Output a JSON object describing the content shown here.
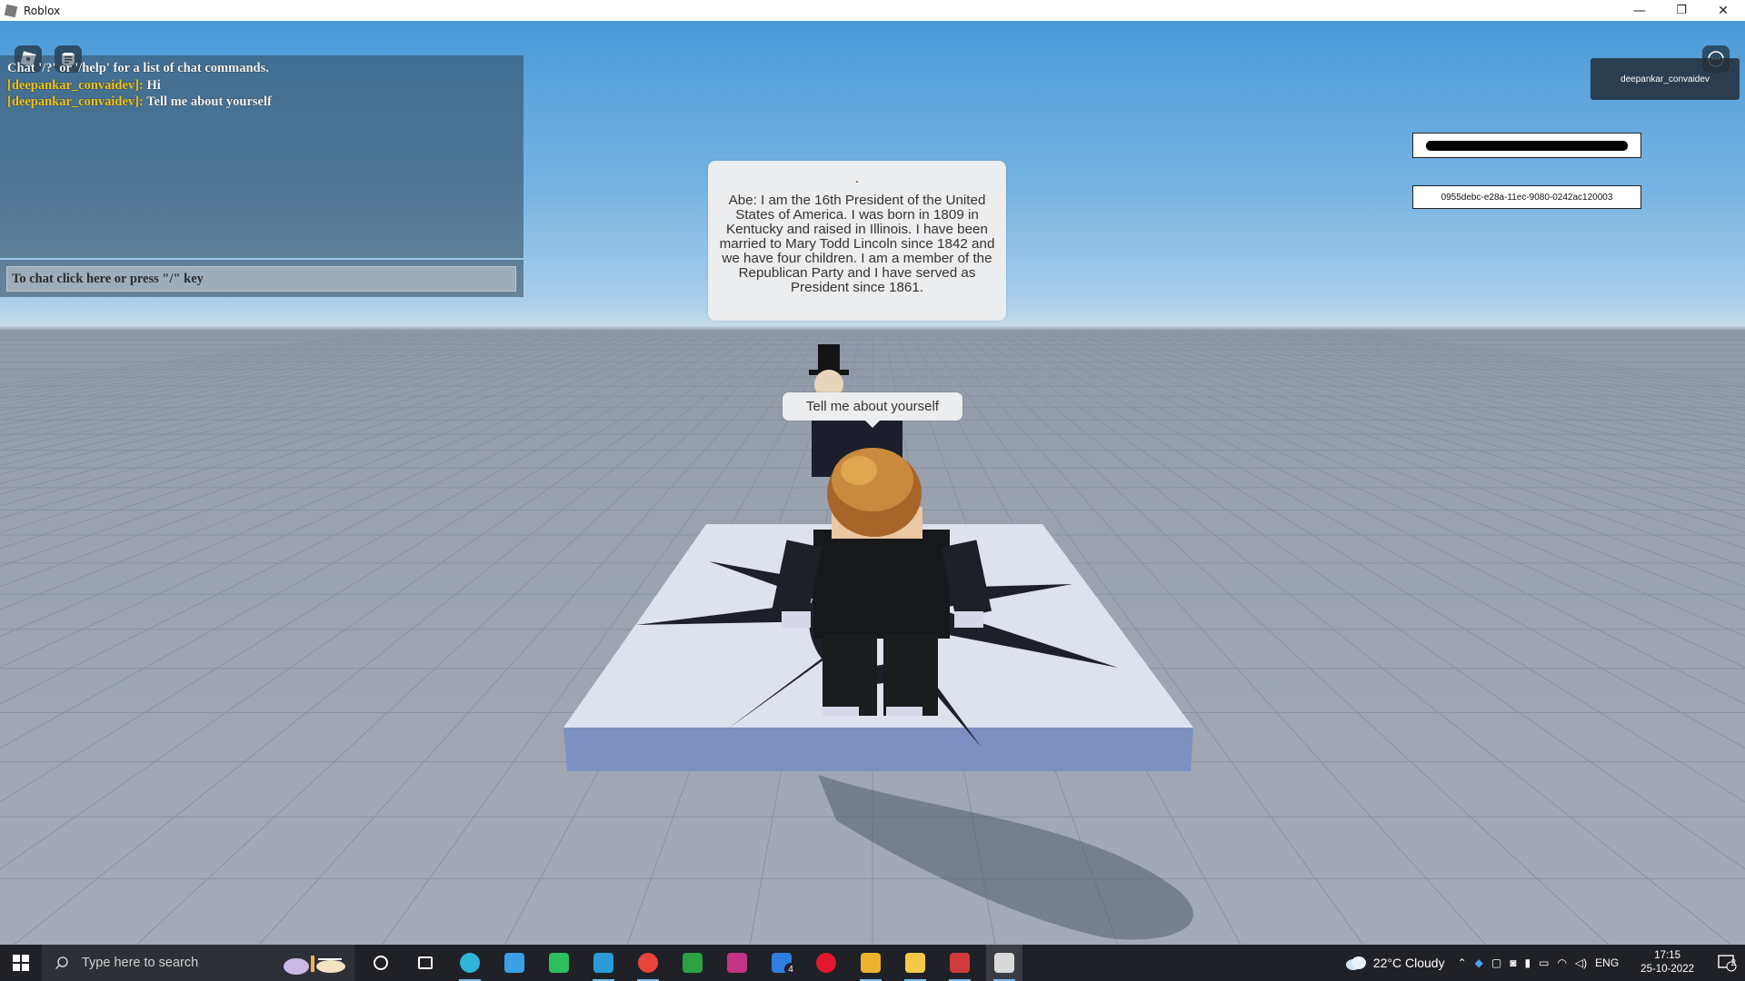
{
  "window": {
    "title": "Roblox",
    "minimize": "—",
    "restore": "❐",
    "close": "✕"
  },
  "chat": {
    "system_message": "Chat '/?' or '/help' for a list of chat commands.",
    "messages": [
      {
        "name": "[deepankar_convaidev]:",
        "text": "Hi"
      },
      {
        "name": "[deepankar_convaidev]:",
        "text": "Tell me about yourself"
      }
    ],
    "input_placeholder": "To chat click here or press \"/\" key"
  },
  "playerlist": {
    "player_name": "deepankar_convaidev"
  },
  "session_id": "0955debc-e28a-11ec-9080-0242ac120003",
  "bubbles": {
    "npc_dot": ".",
    "npc_reply": "Abe: I am the 16th President of the United States of America. I was born in 1809 in Kentucky and raised in Illinois. I have been married to Mary Todd Lincoln since 1842 and we have four children. I am a member of the Republican Party and I have served as President since 1861.",
    "player_message": "Tell me about yourself"
  },
  "taskbar": {
    "search_placeholder": "Type here to search",
    "apps": [
      {
        "name": "cortana",
        "color": "#ffffff"
      },
      {
        "name": "task-view",
        "color": "#ffffff"
      },
      {
        "name": "edge",
        "color": "#2fb4d8"
      },
      {
        "name": "store",
        "color": "#3ba0e6"
      },
      {
        "name": "evernote",
        "color": "#2dbe60"
      },
      {
        "name": "vscode",
        "color": "#2a9bd8"
      },
      {
        "name": "chrome",
        "color": "#e8453c"
      },
      {
        "name": "xbox",
        "color": "#2ca243"
      },
      {
        "name": "instagram",
        "color": "#c13584"
      },
      {
        "name": "todo",
        "color": "#2f7fe0"
      },
      {
        "name": "opera",
        "color": "#e3172c"
      },
      {
        "name": "slack",
        "color": "#ecb22e"
      },
      {
        "name": "file-explorer",
        "color": "#f7c948"
      },
      {
        "name": "roblox-studio",
        "color": "#cf3b3b"
      },
      {
        "name": "roblox",
        "color": "#d9d9d9"
      }
    ],
    "todo_badge": "4",
    "weather": "22°C  Cloudy",
    "language": "ENG",
    "time": "17:15",
    "date": "25-10-2022",
    "notifications": "2"
  }
}
